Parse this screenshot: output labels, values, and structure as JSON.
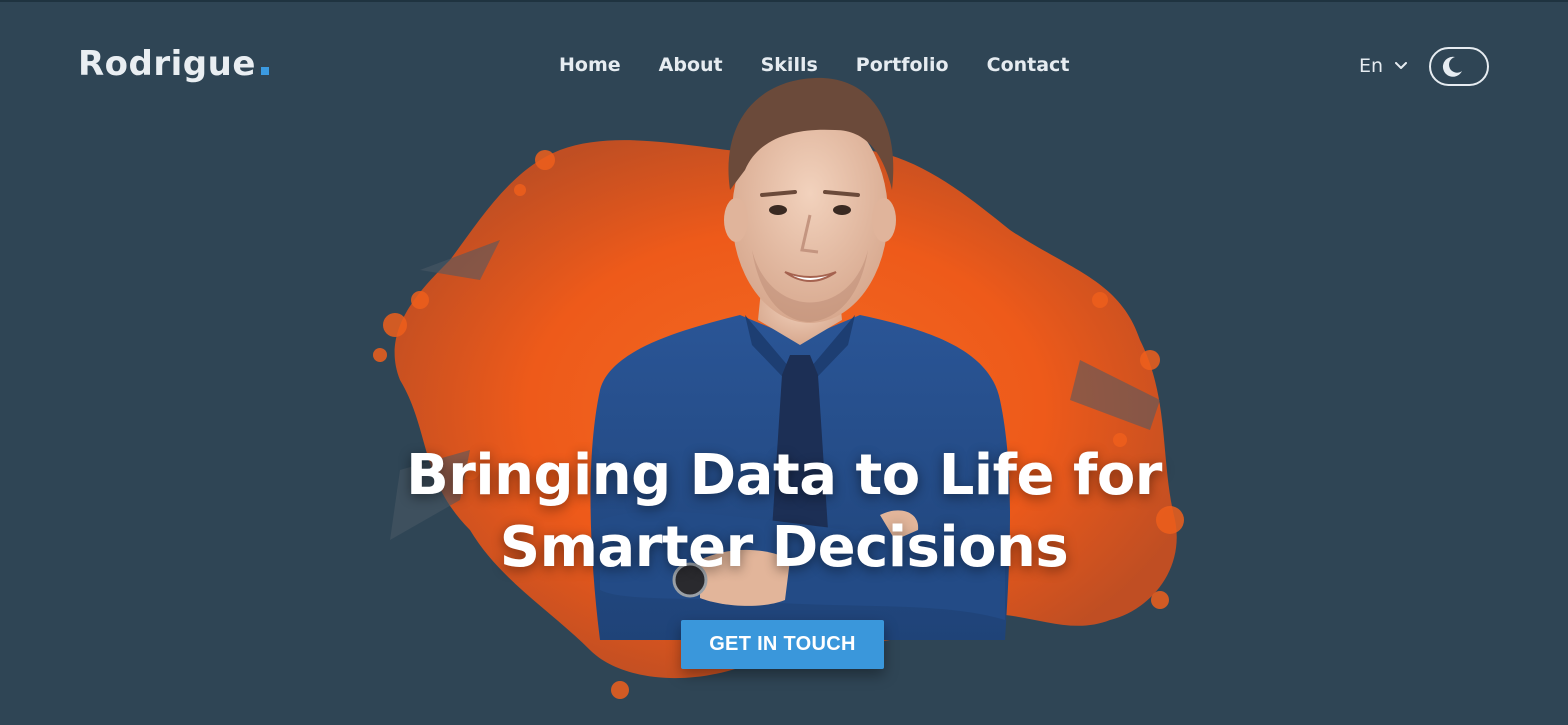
{
  "brand": {
    "name": "Rodrigue",
    "accent": "#3b9ae1"
  },
  "nav": {
    "items": [
      {
        "label": "Home"
      },
      {
        "label": "About"
      },
      {
        "label": "Skills"
      },
      {
        "label": "Portfolio"
      },
      {
        "label": "Contact"
      }
    ]
  },
  "language": {
    "selected": "En",
    "icon": "chevron-down-icon"
  },
  "theme_toggle": {
    "icon": "moon-icon",
    "state": "dark"
  },
  "hero": {
    "headline_line1": "Bringing Data to Life for",
    "headline_line2": "Smarter Decisions",
    "cta_label": "GET IN TOUCH",
    "splash_color": "#f0641e",
    "background": "#2f4555"
  }
}
